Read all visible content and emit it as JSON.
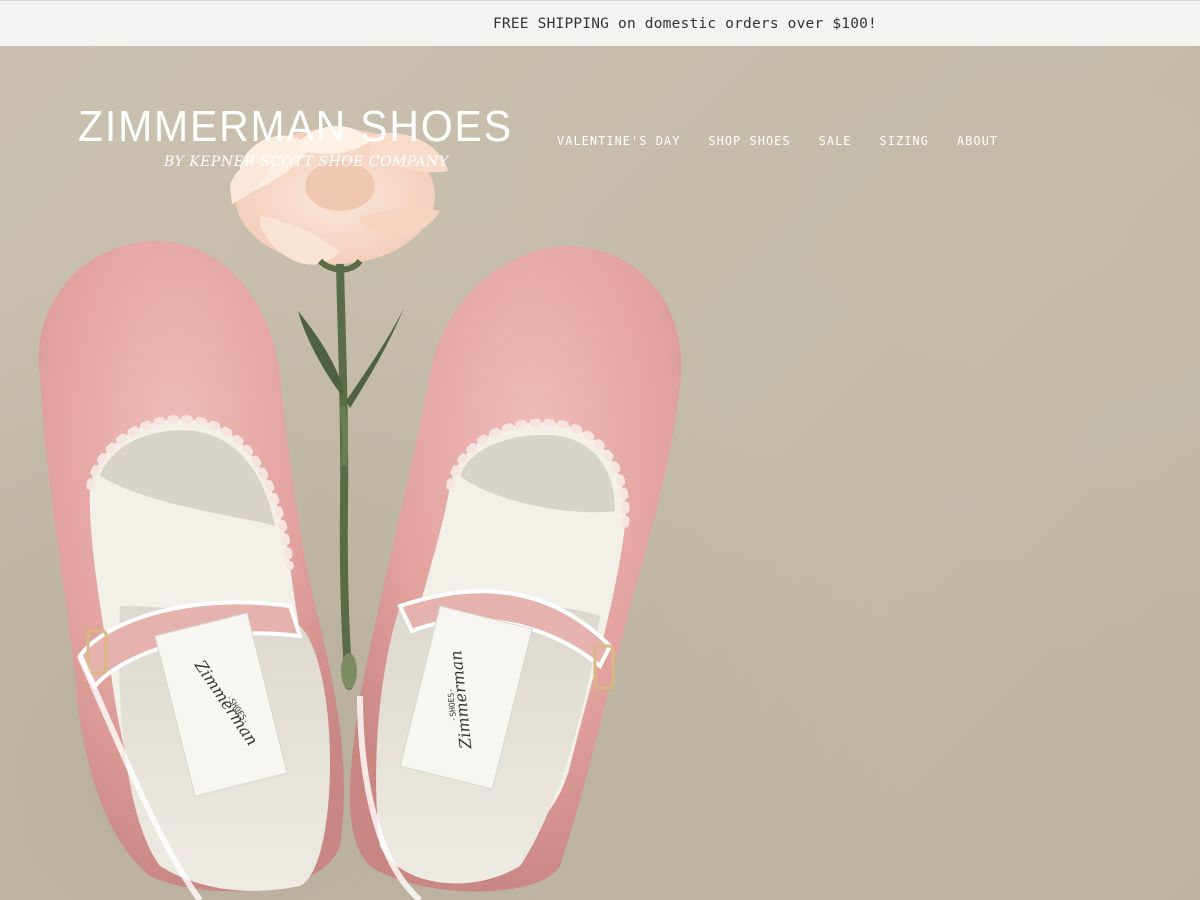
{
  "announcement": {
    "text": "FREE SHIPPING on domestic orders over $100!"
  },
  "header": {
    "logo_title": "ZIMMERMAN SHOES",
    "logo_subtitle": "BY KEPNER SCOTT SHOE COMPANY",
    "nav": [
      {
        "label": "VALENTINE'S DAY"
      },
      {
        "label": "SHOP SHOES"
      },
      {
        "label": "SALE"
      },
      {
        "label": "SIZING"
      },
      {
        "label": "ABOUT"
      }
    ]
  },
  "hero": {
    "insole_label": "Zimmerman -SHOES-"
  },
  "colors": {
    "announcement_bg": "#f5f3f1",
    "backdrop": "#c6bdab",
    "shoe_pink": "#e3a9a5",
    "nav_text": "#ffffff"
  }
}
